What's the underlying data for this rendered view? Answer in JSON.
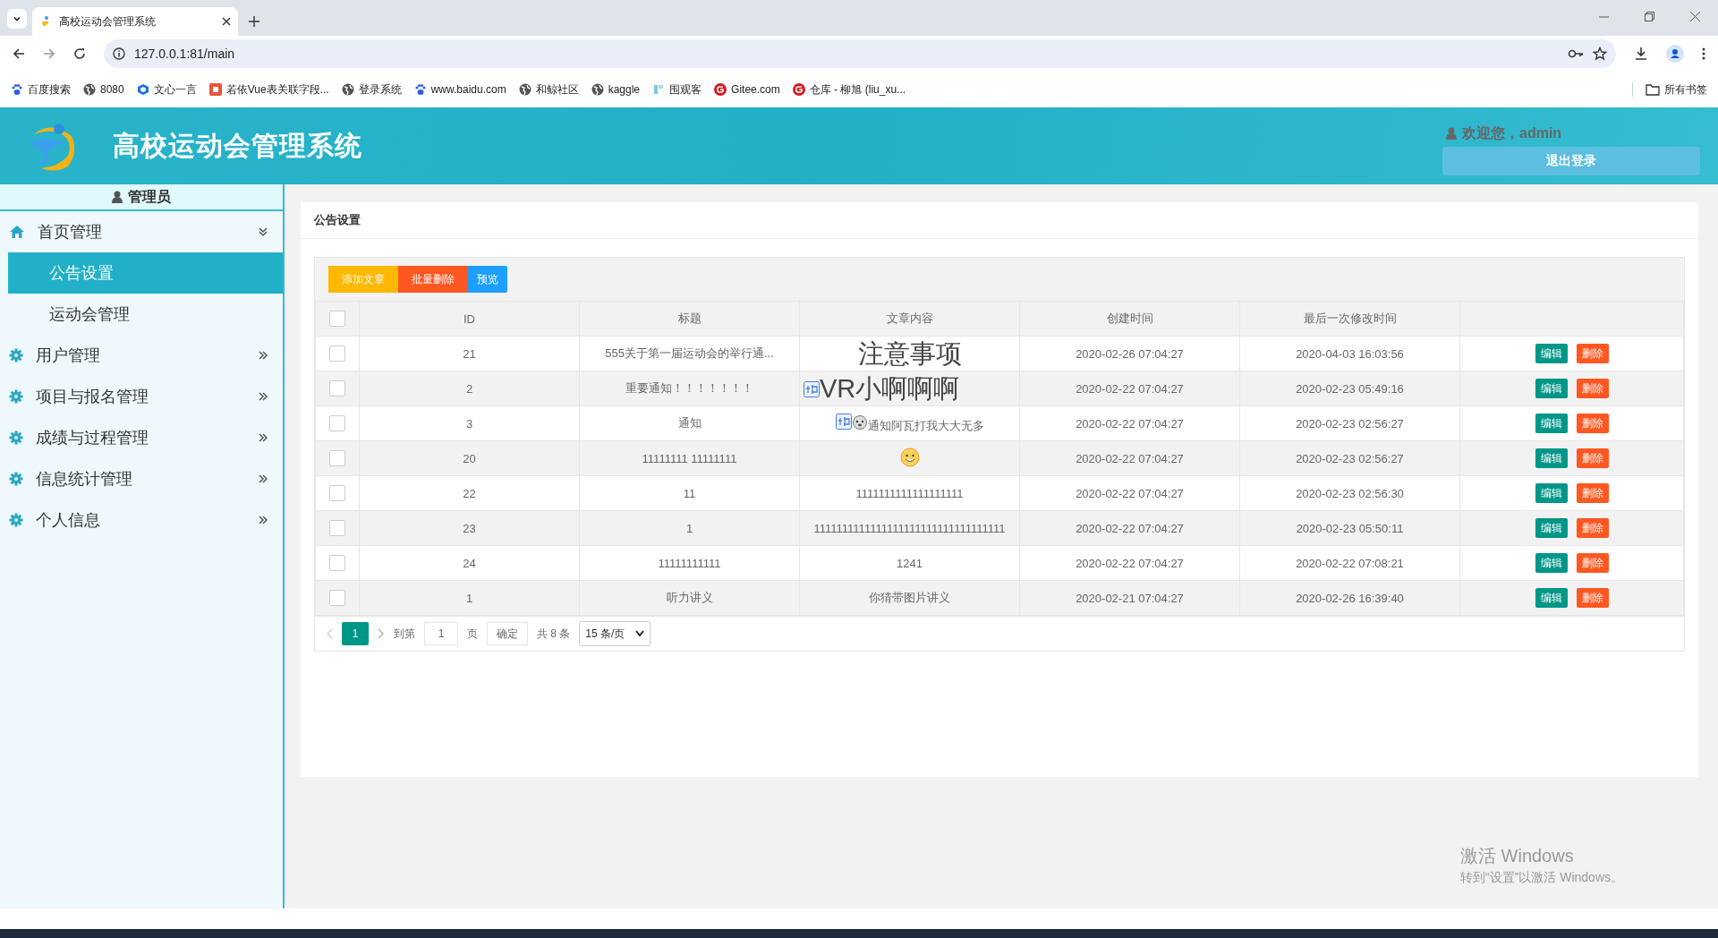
{
  "browser": {
    "tab_title": "高校运动会管理系统",
    "url": "127.0.0.1:81/main",
    "bookmarks": [
      {
        "label": "百度搜索",
        "kind": "paw"
      },
      {
        "label": "8080",
        "kind": "globe"
      },
      {
        "label": "文心一言",
        "kind": "cube"
      },
      {
        "label": "若依Vue表关联字段...",
        "kind": "square"
      },
      {
        "label": "登录系统",
        "kind": "globe"
      },
      {
        "label": "www.baidu.com",
        "kind": "paw"
      },
      {
        "label": "和鲸社区",
        "kind": "globe"
      },
      {
        "label": "kaggle",
        "kind": "globe"
      },
      {
        "label": "围观客",
        "kind": "tile"
      },
      {
        "label": "Gitee.com",
        "kind": "gitee"
      },
      {
        "label": "仓库 - 柳旭 (liu_xu...",
        "kind": "gitee"
      }
    ],
    "bookmarks_folder": "所有书签"
  },
  "header": {
    "title": "高校运动会管理系统",
    "welcome": "欢迎您，admin",
    "logout": "退出登录"
  },
  "sidebar": {
    "role": "管理员",
    "items": [
      {
        "label": "首页管理",
        "kind": "home",
        "expanded": true,
        "children": [
          {
            "label": "公告设置",
            "selected": true
          },
          {
            "label": "运动会管理",
            "selected": false
          }
        ]
      },
      {
        "label": "用户管理",
        "kind": "gear",
        "expanded": false
      },
      {
        "label": "项目与报名管理",
        "kind": "gear",
        "expanded": false
      },
      {
        "label": "成绩与过程管理",
        "kind": "gear",
        "expanded": false
      },
      {
        "label": "信息统计管理",
        "kind": "gear",
        "expanded": false
      },
      {
        "label": "个人信息",
        "kind": "gear",
        "expanded": false
      }
    ]
  },
  "card_title": "公告设置",
  "toolbar": [
    {
      "label": "添加文章",
      "kind": "add"
    },
    {
      "label": "批量删除",
      "kind": "delete"
    },
    {
      "label": "预览",
      "kind": "preview"
    }
  ],
  "table": {
    "select_all": {
      "checked": false
    },
    "columns": [
      "ID",
      "标题",
      "文章内容",
      "创建时间",
      "最后一次修改时间"
    ],
    "rows": [
      {
        "checked": false,
        "id": "21",
        "title": "555关于第一届运动会的举行通...",
        "content": {
          "kind": "large",
          "text": "注意事项"
        },
        "created": "2020-02-26 07:04:27",
        "modified": "2020-04-03 16:03:56",
        "actions": [
          "编辑",
          "删除"
        ]
      },
      {
        "checked": false,
        "id": "2",
        "title": "重要通知！！！！！！！",
        "content": {
          "kind": "large-icon",
          "text": "VR小啊啊啊"
        },
        "created": "2020-02-22 07:04:27",
        "modified": "2020-02-23 05:49:16",
        "actions": [
          "编辑",
          "删除"
        ]
      },
      {
        "checked": false,
        "id": "3",
        "title": "通知",
        "content": {
          "kind": "emoji-text",
          "text": "通知阿瓦打我大大无多"
        },
        "created": "2020-02-22 07:04:27",
        "modified": "2020-02-23 02:56:27",
        "actions": [
          "编辑",
          "删除"
        ]
      },
      {
        "checked": false,
        "id": "20",
        "title": "11111111 11111111",
        "content": {
          "kind": "emoji"
        },
        "created": "2020-02-22 07:04:27",
        "modified": "2020-02-23 02:56:27",
        "actions": [
          "编辑",
          "删除"
        ]
      },
      {
        "checked": false,
        "id": "22",
        "title": "11",
        "content": {
          "kind": "plain",
          "text": "1111111111111111111"
        },
        "created": "2020-02-22 07:04:27",
        "modified": "2020-02-23 02:56:30",
        "actions": [
          "编辑",
          "删除"
        ]
      },
      {
        "checked": false,
        "id": "23",
        "title": "1",
        "content": {
          "kind": "plain",
          "text": "1111111111111111111111111111111111"
        },
        "created": "2020-02-22 07:04:27",
        "modified": "2020-02-23 05:50:11",
        "actions": [
          "编辑",
          "删除"
        ]
      },
      {
        "checked": false,
        "id": "24",
        "title": "11111111111",
        "content": {
          "kind": "plain",
          "text": "1241"
        },
        "created": "2020-02-22 07:04:27",
        "modified": "2020-02-22 07:08:21",
        "actions": [
          "编辑",
          "删除"
        ]
      },
      {
        "checked": false,
        "id": "1",
        "title": "听力讲义",
        "content": {
          "kind": "plain",
          "text": "你猜带图片讲义"
        },
        "created": "2020-02-21 07:04:27",
        "modified": "2020-02-26 16:39:40",
        "actions": [
          "编辑",
          "删除"
        ]
      }
    ]
  },
  "pagination": {
    "pages": [
      {
        "label": "1",
        "selected": true
      }
    ],
    "goto": "到第",
    "input": "1",
    "unit": "页",
    "confirm": "确定",
    "total": "共 8 条",
    "page_size": "15 条/页"
  },
  "activation": {
    "title": "激活 Windows",
    "subtitle": "转到“设置”以激活 Windows。"
  }
}
